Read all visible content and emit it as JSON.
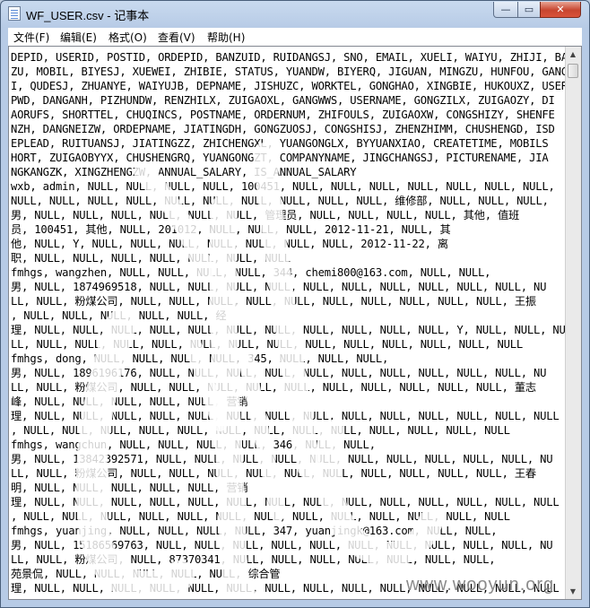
{
  "window": {
    "title": "WF_USER.csv - 记事本",
    "controls": {
      "minimize": "—",
      "maximize": "▭",
      "close": "✕"
    }
  },
  "menu": {
    "file": "文件(F)",
    "edit": "编辑(E)",
    "format": "格式(O)",
    "view": "查看(V)",
    "help": "帮助(H)"
  },
  "editor": {
    "content": "DEPID, USERID, POSTID, ORDEPID, BANZUID, RUIDANGSJ, SNO, EMAIL, XUELI, WAIYU, ZHIJI, BAN\nZU, MOBIL, BIYESJ, XUEWEI, ZHIBIE, STATUS, YUANDW, BIYERQ, JIGUAN, MINGZU, HUNFOU, GANGJ\nI, QUDESJ, ZHUANYE, WAIYUJB, DEPNAME, JISHUZC, WORKTEL, GONGHAO, XINGBIE, HUKOUXZ, USER\nPWD, DANGANH, PIZHUNDW, RENZHILX, ZUIGAOXL, GANGWWS, USERNAME, GONGZILX, ZUIGAOZY, DI\nAORUFS, SHORTTEL, CHUQINCS, POSTNAME, ORDERNUM, ZHIFOULS, ZUIGAOXW, CONGSHIZY, SHENFE\nNZH, DANGNEIZW, ORDEPNAME, JIATINGDH, GONGZUOSJ, CONGSHISJ, ZHENZHIMM, CHUSHENGD, ISD\nEPLEAD, RUITUANSJ, JIATINGZZ, ZHICHENGXL, YUANGONGLX, BYYUANXIAO, CREATETIME, MOBILS\nHORT, ZUIGAOBYYX, CHUSHENGRQ, YUANGONGZT, COMPANYNAME, JINGCHANGSJ, PICTURENAME, JIA\nNGKANGZK, XINGZHENGZW, ANNUAL_SALARY, IS_ANNUAL_SALARY\nwxb, admin, NULL, NULL, NULL, NULL, 100451, NULL, NULL, NULL, NULL, NULL, NULL, NULL,\nNULL, NULL, NULL, NULL, NULL, NULL, NULL, NULL, NULL, NULL, 维修部, NULL, NULL, NULL,\n男, NULL, NULL, NULL, NULL, NULL, NULL, 管理员, NULL, NULL, NULL, NULL, 其他, 值班\n员, 100451, 其他, NULL, 201012, NULL, NULL, NULL, 2012-11-21, NULL, 其\n他, NULL, Y, NULL, NULL, NULL, NULL, NULL, NULL, NULL, 2012-11-22, 离\n职, NULL, NULL, NULL, NULL, NULL, NULL, NULL\nfmhgs, wangzhen, NULL, NULL, NULL, NULL, 344, chemi800@163.com, NULL, NULL,\n男, NULL, 1874969518, NULL, NULL, NULL, NULL, NULL, NULL, NULL, NULL, NULL, NULL, NU\nLL, NULL, 粉煤公司, NULL, NULL, NULL, NULL, NULL, NULL, NULL, NULL, NULL, NULL, 王振\n, NULL, NULL, NULL, NULL, NULL, 经\n理, NULL, NULL, NULL, NULL, NULL, NULL, NULL, NULL, NULL, NULL, NULL, Y, NULL, NULL, NU\nLL, NULL, NULL, NULL, NULL, NULL, NULL, NULL, NULL, NULL, NULL, NULL, NULL, NULL\nfmhgs, dong, NULL, NULL, NULL, NULL, 345, NULL, NULL, NULL,\n男, NULL, 1896196176, NULL, NULL, NULL, NULL, NULL, NULL, NULL, NULL, NULL, NULL, NU\nLL, NULL, 粉煤公司, NULL, NULL, NULL, NULL, NULL, NULL, NULL, NULL, NULL, NULL, 董志\n峰, NULL, NULL, NULL, NULL, NULL, 营销\n理, NULL, NULL, NULL, NULL, NULL, NULL, NULL, NULL, NULL, NULL, NULL, NULL, NULL, NULL\n, NULL, NULL, NULL, NULL, NULL, NULL, NULL, NULL, NULL, NULL, NULL, NULL, NULL\nfmhgs, wangchun, NULL, NULL, NULL, NULL, 346, NULL, NULL,\n男, NULL, 13842392571, NULL, NULL, NULL, NULL, NULL, NULL, NULL, NULL, NULL, NULL, NU\nLL, NULL, 粉煤公司, NULL, NULL, NULL, NULL, NULL, NULL, NULL, NULL, NULL, NULL, 王春\n明, NULL, NULL, NULL, NULL, NULL, 营销\n理, NULL, NULL, NULL, NULL, NULL, NULL, NULL, NULL, NULL, NULL, NULL, NULL, NULL, NULL\n, NULL, NULL, NULL, NULL, NULL, NULL, NULL, NULL, NULL, NULL, NULL, NULL, NULL\nfmhgs, yuanjing, NULL, NULL, NULL, NULL, 347, yuanjingk@163.com, NULL, NULL,\n男, NULL, 15186569763, NULL, NULL, NULL, NULL, NULL, NULL, NULL, NULL, NULL, NULL, NU\nLL, NULL, 粉煤公司, NULL, 87370341, NULL, NULL, NULL, NULL, NULL, NULL, NULL,\n苑景侃, NULL, NULL, NULL, NULL, NULL, 综合管\n理, NULL, NULL, NULL, NULL, NULL, NULL, NULL, NULL, NULL, NULL, NULL, NULL, NULL, NULL"
  },
  "watermark": "www.wooyun.org"
}
